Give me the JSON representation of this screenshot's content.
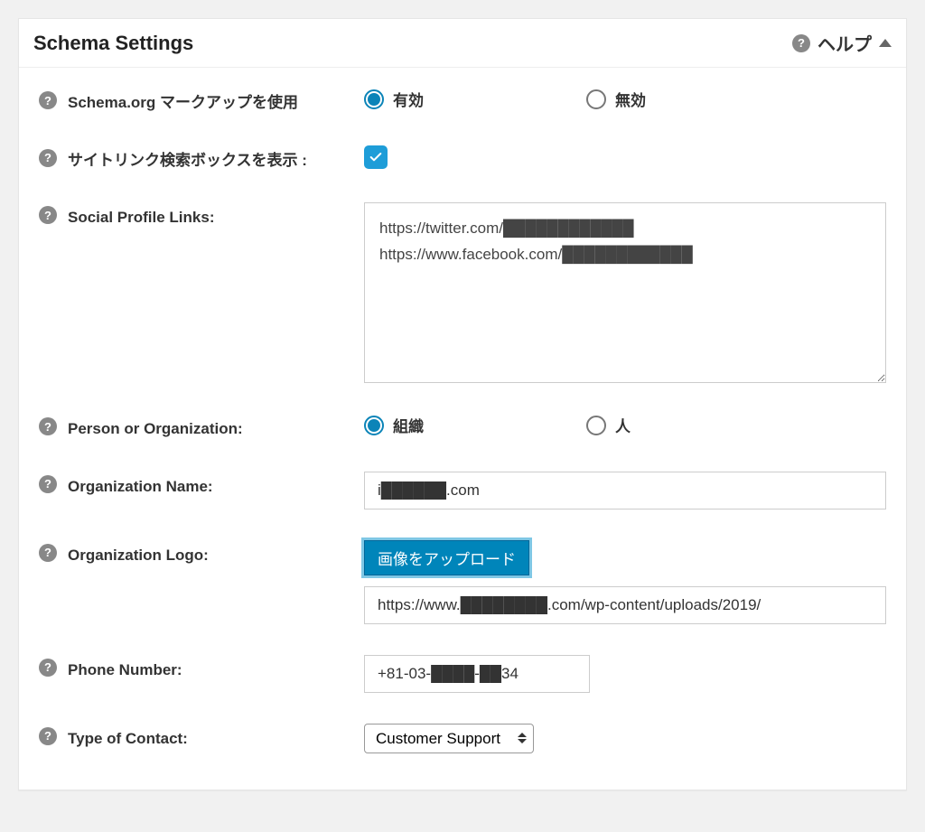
{
  "panel": {
    "title": "Schema Settings",
    "help_label": "ヘルプ"
  },
  "rows": {
    "schema_markup": {
      "label": "Schema.org マークアップを使用",
      "opt_enabled": "有効",
      "opt_disabled": "無効",
      "selected": "enabled"
    },
    "sitelinks_search": {
      "label": "サイトリンク検索ボックスを表示 :",
      "checked": true
    },
    "social_links": {
      "label": "Social Profile Links:",
      "value": "https://twitter.com/████████████\nhttps://www.facebook.com/████████████"
    },
    "person_org": {
      "label": "Person or Organization:",
      "opt_org": "組織",
      "opt_person": "人",
      "selected": "org"
    },
    "org_name": {
      "label": "Organization Name:",
      "value": "i██████.com"
    },
    "org_logo": {
      "label": "Organization Logo:",
      "button": "画像をアップロード",
      "value": "https://www.████████.com/wp-content/uploads/2019/"
    },
    "phone": {
      "label": "Phone Number:",
      "value": "+81-03-████-██34"
    },
    "contact_type": {
      "label": "Type of Contact:",
      "selected": "Customer Support"
    }
  }
}
